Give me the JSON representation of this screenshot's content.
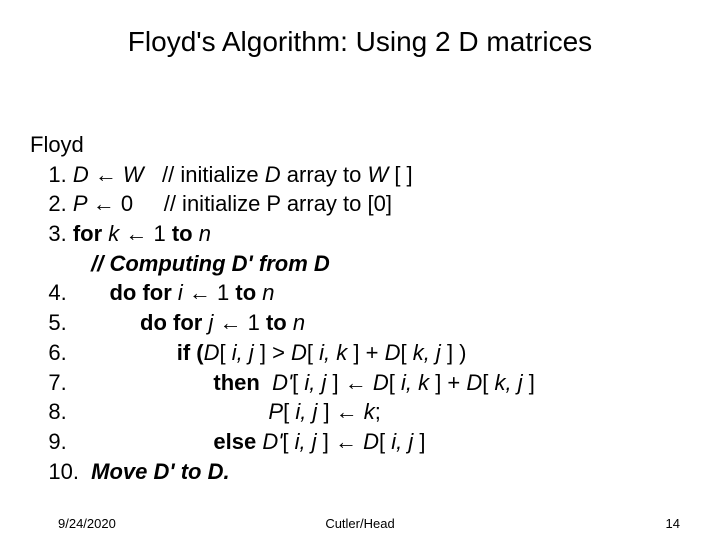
{
  "title": "Floyd's Algorithm: Using 2 D matrices",
  "algo": {
    "name": "Floyd",
    "l1_num": "1. ",
    "l1_a": "D ",
    "arrow": "←",
    "l1_b": " W",
    "l1_c": "   // initialize ",
    "l1_d": "D",
    "l1_e": " array to ",
    "l1_f": "W",
    "l1_g": " [ ]",
    "l2_num": "2. ",
    "l2_a": "P ",
    "l2_b": " 0",
    "l2_c": "     // initialize P array to [0]",
    "l3_num": "3. ",
    "l3_a": "for ",
    "l3_b": "k ",
    "l3_c": " 1 ",
    "l3_d": "to",
    "l3_e": " n",
    "comment": "// Computing D' from D",
    "l4_num": "4.       ",
    "l4_a": "do for ",
    "l4_b": "i ",
    "l4_c": " 1 ",
    "l4_d": "to",
    "l4_e": " n",
    "l5_num": "5.            ",
    "l5_a": "do for ",
    "l5_b": "j ",
    "l5_c": " 1 ",
    "l5_d": "to",
    "l5_e": " n",
    "l6_num": "6.                  ",
    "l6_a": "if (",
    "l6_b": "D",
    "l6_c": "[ ",
    "l6_d": "i, j",
    "l6_e": " ] > ",
    "l6_f": "D",
    "l6_g": "[ ",
    "l6_h": "i, k",
    "l6_i": " ] + ",
    "l6_j": "D",
    "l6_k": "[ ",
    "l6_l": "k, j",
    "l6_m": " ] )",
    "l7_num": "7.                        ",
    "l7_a": "then  ",
    "l7_b": "D'",
    "l7_c": "[ ",
    "l7_d": "i, j",
    "l7_e": " ] ",
    "l7_f": " D",
    "l7_g": "[ ",
    "l7_h": "i, k",
    "l7_i": " ] + ",
    "l7_j": "D",
    "l7_k": "[ ",
    "l7_l": "k, j",
    "l7_m": " ]",
    "l8_num": "8.                                 ",
    "l8_a": "P",
    "l8_b": "[ ",
    "l8_c": "i, j",
    "l8_d": " ] ",
    "l8_e": " k",
    "l8_f": ";",
    "l9_num": "9.                        ",
    "l9_a": "else ",
    "l9_b": "D'",
    "l9_c": "[ ",
    "l9_d": "i, j",
    "l9_e": " ] ",
    "l9_f": " D",
    "l9_g": "[ ",
    "l9_h": "i, j",
    "l9_i": " ]",
    "l10_num": "10.  ",
    "l10_a": "Move D' to D."
  },
  "footer": {
    "date": "9/24/2020",
    "center": "Cutler/Head",
    "page": "14"
  }
}
